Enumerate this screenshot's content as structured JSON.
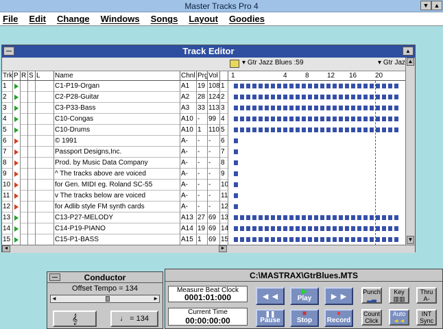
{
  "app": {
    "title": "Master Tracks Pro 4"
  },
  "menu": [
    "File",
    "Edit",
    "Change",
    "Windows",
    "Songs",
    "Layout",
    "Goodies"
  ],
  "track_editor": {
    "title": "Track Editor",
    "ruler_track_a": "Gtr Jazz Blues :59",
    "ruler_track_b": "Gtr Jaz",
    "ruler_marks": [
      "1",
      "4",
      "8",
      "12",
      "16",
      "20"
    ],
    "headers": [
      "Trk",
      "P",
      "R",
      "S",
      "L",
      "Name",
      "Chnl",
      "Prg",
      "Vol"
    ],
    "rows": [
      {
        "trk": "1",
        "name": "C1-P19-Organ",
        "chnl": "A1",
        "prg": "19",
        "vol": "108",
        "num": "1"
      },
      {
        "trk": "2",
        "name": "C2-P28-Guitar",
        "chnl": "A2",
        "prg": "28",
        "vol": "124",
        "num": "2"
      },
      {
        "trk": "3",
        "name": "C3-P33-Bass",
        "chnl": "A3",
        "prg": "33",
        "vol": "113",
        "num": "3"
      },
      {
        "trk": "4",
        "name": "C10-Congas",
        "chnl": "A10",
        "prg": "-",
        "vol": "99",
        "num": "4"
      },
      {
        "trk": "5",
        "name": "C10-Drums",
        "chnl": "A10",
        "prg": "1",
        "vol": "110",
        "num": "5"
      },
      {
        "trk": "6",
        "name": "© 1991",
        "chnl": "A-",
        "prg": "-",
        "vol": "-",
        "num": "6"
      },
      {
        "trk": "7",
        "name": "Passport Designs,Inc.",
        "chnl": "A-",
        "prg": "-",
        "vol": "-",
        "num": "7"
      },
      {
        "trk": "8",
        "name": "Prod. by Music Data Company",
        "chnl": "A-",
        "prg": "-",
        "vol": "-",
        "num": "8"
      },
      {
        "trk": "9",
        "name": "^ The tracks above are voiced",
        "chnl": "A-",
        "prg": "-",
        "vol": "-",
        "num": "9"
      },
      {
        "trk": "10",
        "name": "for Gen. MIDI eg. Roland SC-55",
        "chnl": "A-",
        "prg": "-",
        "vol": "-",
        "num": "10"
      },
      {
        "trk": "11",
        "name": "v  The tracks below are voiced",
        "chnl": "A-",
        "prg": "-",
        "vol": "-",
        "num": "11"
      },
      {
        "trk": "12",
        "name": "for Adlib style FM synth cards",
        "chnl": "A-",
        "prg": "-",
        "vol": "-",
        "num": "12"
      },
      {
        "trk": "13",
        "name": "C13-P27-MELODY",
        "chnl": "A13",
        "prg": "27",
        "vol": "69",
        "num": "13"
      },
      {
        "trk": "14",
        "name": "C14-P19-PIANO",
        "chnl": "A14",
        "prg": "19",
        "vol": "69",
        "num": "14"
      },
      {
        "trk": "15",
        "name": "C15-P1-BASS",
        "chnl": "A15",
        "prg": "1",
        "vol": "69",
        "num": "15"
      }
    ],
    "colors": {
      "blocks": "#3650a8",
      "title": "#2e4fa0",
      "play_arrow": "#22a02a",
      "rec_arrow": "#d04020"
    }
  },
  "conductor": {
    "title": "Conductor",
    "offset_tempo": "Offset Tempo = 134",
    "tempo_button": "♩ = 134"
  },
  "transport": {
    "file": "C:\\MASTRAX\\GtrBlues.MTS",
    "mbc_label": "Measure  Beat  Clock",
    "mbc_value": "0001:01:000",
    "time_label": "Current Time",
    "time_value": "00:00:00:00",
    "play": "Play",
    "pause": "Pause",
    "stop": "Stop",
    "record": "Record",
    "punch": "Punch",
    "key": "Key",
    "thru": "Thru",
    "thru_val": "A-",
    "count": "Count",
    "click": "Click",
    "auto": "Auto",
    "int": "INT",
    "sync": "Sync"
  }
}
